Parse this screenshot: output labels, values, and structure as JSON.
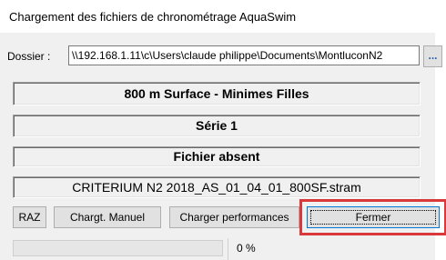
{
  "window": {
    "title": "Chargement des fichiers de chronométrage AquaSwim"
  },
  "folder": {
    "label": "Dossier :",
    "path": "\\\\192.168.1.11\\c\\Users\\claude philippe\\Documents\\MontluconN2",
    "browse_label": "..."
  },
  "info": {
    "event": "800 m Surface  -  Minimes Filles",
    "series": "Série  1",
    "file_status": "Fichier absent",
    "file_name": "CRITERIUM N2 2018_AS_01_04_01_800SF.stram"
  },
  "buttons": {
    "raz": "RAZ",
    "manual": "Chargt. Manuel",
    "load_perf": "Charger performances",
    "close": "Fermer"
  },
  "progress": {
    "value": 0,
    "label": "0 %"
  },
  "colors": {
    "highlight": "#d9393a",
    "browse_icon": "#2b5fad"
  }
}
